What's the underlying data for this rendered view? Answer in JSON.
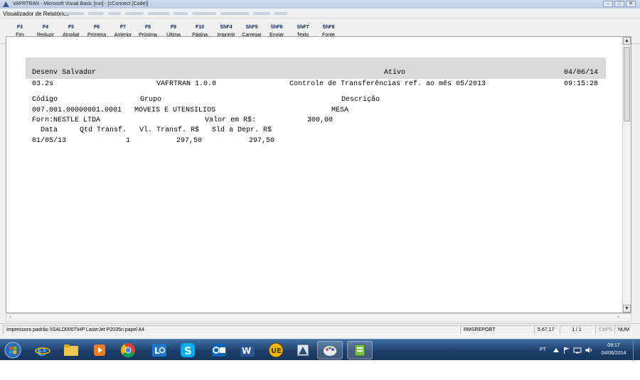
{
  "background_window": {
    "title": "VAFRTRAN - Microsoft Visual Basic [run] - [cConnect (Code)]",
    "controls": [
      "–",
      "□",
      "✕"
    ]
  },
  "viewer": {
    "title": "Visualizador de Relatórios"
  },
  "toolbar": {
    "buttons": [
      {
        "key": "F3",
        "label": "Fim"
      },
      {
        "key": "F4",
        "label": "Reduzir"
      },
      {
        "key": "F5",
        "label": "Ampliar"
      },
      {
        "key": "F6",
        "label": "Primeira"
      },
      {
        "key": "F7",
        "label": "Anterior"
      },
      {
        "key": "F8",
        "label": "Próxima"
      },
      {
        "key": "F9",
        "label": "Última"
      },
      {
        "key": "F10",
        "label": "Página"
      },
      {
        "key": "ShF4",
        "label": "Imprimir"
      },
      {
        "key": "ShF5",
        "label": "Carregar"
      },
      {
        "key": "ShF6",
        "label": "Enviar"
      },
      {
        "key": "ShF7",
        "label": "Texto"
      },
      {
        "key": "ShF8",
        "label": "Fonte"
      }
    ]
  },
  "report": {
    "company": "Desenv Salvador",
    "status": "Ativo",
    "date": "04/06/14",
    "version_code": "03.2s",
    "system": "VAFRTRAN 1.0.0",
    "report_title": "Controle de Transferências ref. ao mês 05/2013",
    "time": "09:15:28",
    "col_codigo": "Código",
    "col_grupo": "Grupo",
    "col_descricao": "Descrição",
    "item_code": "007.001.00000001.0001",
    "item_group": "MOVEIS E UTENSILIOS",
    "item_description": "MESA",
    "supplier": "Forn:NESTLE LTDA",
    "value_label": "Valor em R$:",
    "value": "300,00",
    "detail_header_data": "Data",
    "detail_header_qtd": "Qtd Transf.",
    "detail_header_vl": "Vl. Transf. R$",
    "detail_header_sld": "Sld a Depr. R$",
    "detail_row": {
      "date": "01/05/13",
      "qty": "1",
      "vl": "297,50",
      "sld": "297,50"
    }
  },
  "statusbar": {
    "printer": "Impressora padrão \\\\SALD0007\\HP LaserJet P2035n papel A4",
    "module": "RMSREPORT",
    "version": "5.67.17",
    "page": "1 / 1",
    "caps": "CAPS",
    "num": "NUM"
  },
  "taskbar": {
    "language": "PT",
    "time": "09:17",
    "date": "04/06/2014"
  },
  "colors": {
    "taskbar": "#1d3f6b",
    "header_band": "#d9d9d9",
    "toolbar_key": "#0a246a"
  }
}
